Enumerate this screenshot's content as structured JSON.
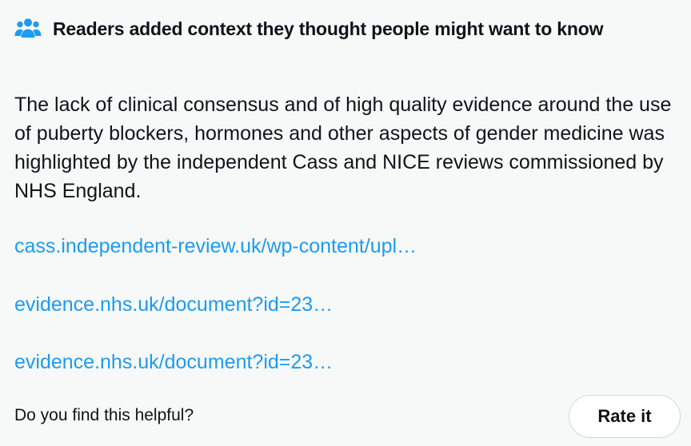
{
  "colors": {
    "background": "#f7f9f9",
    "text": "#0f1419",
    "link": "#1d9bf0",
    "icon": "#1d9bf0",
    "button_border": "#cfd9de",
    "button_background": "#ffffff"
  },
  "header": {
    "icon": "people-icon",
    "title": "Readers added context they thought people might want to know"
  },
  "note": {
    "text": "The lack of clinical consensus and of high quality evidence around the use of puberty blockers, hormones and other aspects of gender medicine was highlighted by the independent Cass and NICE reviews commissioned by NHS England.",
    "links": [
      "cass.independent-review.uk/wp-content/upl…",
      "evidence.nhs.uk/document?id=23…",
      "evidence.nhs.uk/document?id=23…"
    ]
  },
  "footer": {
    "question": "Do you find this helpful?",
    "rate_label": "Rate it"
  }
}
